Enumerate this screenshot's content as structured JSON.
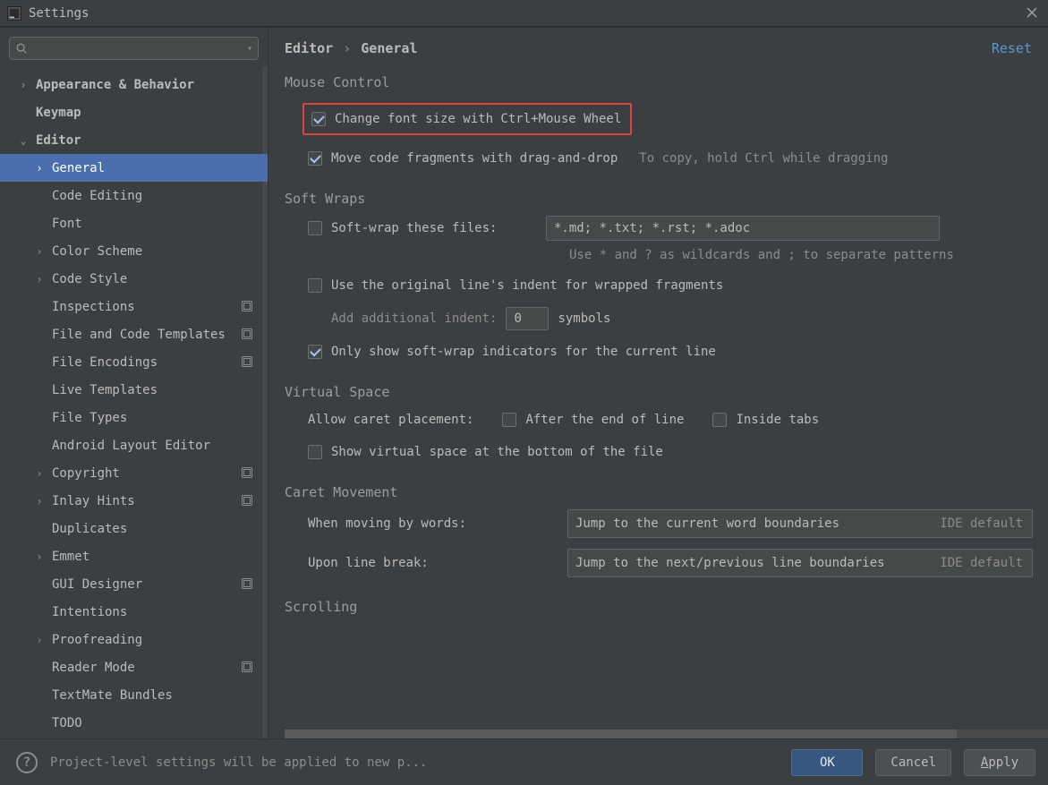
{
  "titlebar": {
    "title": "Settings"
  },
  "search": {
    "placeholder": ""
  },
  "sidebar": {
    "items": [
      {
        "label": "Appearance & Behavior",
        "indent": 0,
        "expandable": true,
        "expanded": false,
        "bold": true
      },
      {
        "label": "Keymap",
        "indent": 0,
        "expandable": false,
        "bold": true
      },
      {
        "label": "Editor",
        "indent": 0,
        "expandable": true,
        "expanded": true,
        "bold": true
      },
      {
        "label": "General",
        "indent": 1,
        "expandable": true,
        "expanded": false,
        "selected": true
      },
      {
        "label": "Code Editing",
        "indent": 1,
        "expandable": false
      },
      {
        "label": "Font",
        "indent": 1,
        "expandable": false
      },
      {
        "label": "Color Scheme",
        "indent": 1,
        "expandable": true,
        "expanded": false
      },
      {
        "label": "Code Style",
        "indent": 1,
        "expandable": true,
        "expanded": false
      },
      {
        "label": "Inspections",
        "indent": 1,
        "expandable": false,
        "scope": true
      },
      {
        "label": "File and Code Templates",
        "indent": 1,
        "expandable": false,
        "scope": true
      },
      {
        "label": "File Encodings",
        "indent": 1,
        "expandable": false,
        "scope": true
      },
      {
        "label": "Live Templates",
        "indent": 1,
        "expandable": false
      },
      {
        "label": "File Types",
        "indent": 1,
        "expandable": false
      },
      {
        "label": "Android Layout Editor",
        "indent": 1,
        "expandable": false
      },
      {
        "label": "Copyright",
        "indent": 1,
        "expandable": true,
        "expanded": false,
        "scope": true
      },
      {
        "label": "Inlay Hints",
        "indent": 1,
        "expandable": true,
        "expanded": false,
        "scope": true
      },
      {
        "label": "Duplicates",
        "indent": 1,
        "expandable": false
      },
      {
        "label": "Emmet",
        "indent": 1,
        "expandable": true,
        "expanded": false
      },
      {
        "label": "GUI Designer",
        "indent": 1,
        "expandable": false,
        "scope": true
      },
      {
        "label": "Intentions",
        "indent": 1,
        "expandable": false
      },
      {
        "label": "Proofreading",
        "indent": 1,
        "expandable": true,
        "expanded": false
      },
      {
        "label": "Reader Mode",
        "indent": 1,
        "expandable": false,
        "scope": true
      },
      {
        "label": "TextMate Bundles",
        "indent": 1,
        "expandable": false
      },
      {
        "label": "TODO",
        "indent": 1,
        "expandable": false
      }
    ]
  },
  "breadcrumb": {
    "part1": "Editor",
    "sep": "›",
    "part2": "General"
  },
  "reset": "Reset",
  "sections": {
    "mouse": {
      "title": "Mouse Control",
      "change_font": "Change font size with Ctrl+Mouse Wheel",
      "change_font_checked": true,
      "move_frag": "Move code fragments with drag-and-drop",
      "move_frag_checked": true,
      "move_frag_hint": "To copy, hold Ctrl while dragging"
    },
    "softwraps": {
      "title": "Soft Wraps",
      "softwrap_files": "Soft-wrap these files:",
      "softwrap_files_checked": false,
      "softwrap_value": "*.md; *.txt; *.rst; *.adoc",
      "wildcard_hint": "Use * and ? as wildcards and ; to separate patterns",
      "original_indent": "Use the original line's indent for wrapped fragments",
      "original_indent_checked": false,
      "add_indent_label": "Add additional indent:",
      "add_indent_value": "0",
      "add_indent_suffix": "symbols",
      "only_show": "Only show soft-wrap indicators for the current line",
      "only_show_checked": true
    },
    "virtual": {
      "title": "Virtual Space",
      "allow_caret": "Allow caret placement:",
      "after_eol": "After the end of line",
      "after_eol_checked": false,
      "inside_tabs": "Inside tabs",
      "inside_tabs_checked": false,
      "show_virtual": "Show virtual space at the bottom of the file",
      "show_virtual_checked": false
    },
    "caret": {
      "title": "Caret Movement",
      "by_words_label": "When moving by words:",
      "by_words_value": "Jump to the current word boundaries",
      "by_words_meta": "IDE default",
      "line_break_label": "Upon line break:",
      "line_break_value": "Jump to the next/previous line boundaries",
      "line_break_meta": "IDE default"
    },
    "scrolling": {
      "title": "Scrolling"
    }
  },
  "footer": {
    "message": "Project-level settings will be applied to new p...",
    "ok": "OK",
    "cancel": "Cancel",
    "apply_pre": "A",
    "apply_rest": "pply"
  }
}
